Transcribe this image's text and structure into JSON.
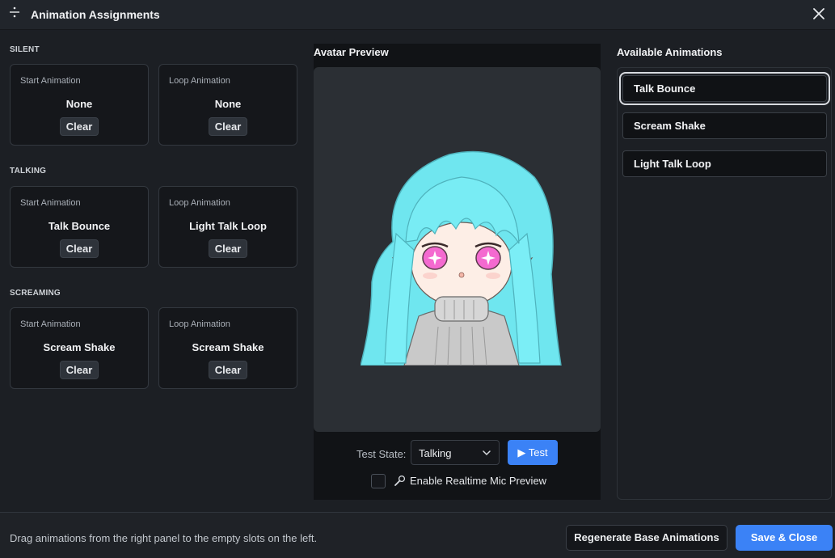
{
  "window": {
    "title": "Animation Assignments",
    "icons": {
      "title": "divide-icon",
      "close": "close-icon"
    }
  },
  "sections": [
    {
      "label": "SILENT",
      "slots": [
        {
          "label": "Start Animation",
          "value": "None",
          "button": "Clear"
        },
        {
          "label": "Loop Animation",
          "value": "None",
          "button": "Clear"
        }
      ]
    },
    {
      "label": "TALKING",
      "slots": [
        {
          "label": "Start Animation",
          "value": "Talk Bounce",
          "button": "Clear"
        },
        {
          "label": "Loop Animation",
          "value": "Light Talk Loop",
          "button": "Clear"
        }
      ]
    },
    {
      "label": "SCREAMING",
      "slots": [
        {
          "label": "Start Animation",
          "value": "Scream Shake",
          "button": "Clear"
        },
        {
          "label": "Loop Animation",
          "value": "Scream Shake",
          "button": "Clear"
        }
      ]
    }
  ],
  "preview": {
    "title": "Avatar Preview",
    "test_state_label": "Test State:",
    "test_state_value": "Talking",
    "test_button": "▶ Test",
    "mic_checkbox_checked": false,
    "mic_label": "Enable Realtime Mic Preview"
  },
  "available": {
    "title": "Available Animations",
    "items": [
      "Talk Bounce",
      "Scream Shake",
      "Light Talk Loop"
    ],
    "selected_index": 0
  },
  "footer": {
    "hint": "Drag animations from the right panel to the empty slots on the left.",
    "regenerate_button": "Regenerate Base Animations",
    "save_button": "Save & Close"
  },
  "colors": {
    "accent": "#3b82f6",
    "background": "#1c1f24",
    "panel": "#15171b",
    "avatar_hair": "#6fe6ef"
  }
}
